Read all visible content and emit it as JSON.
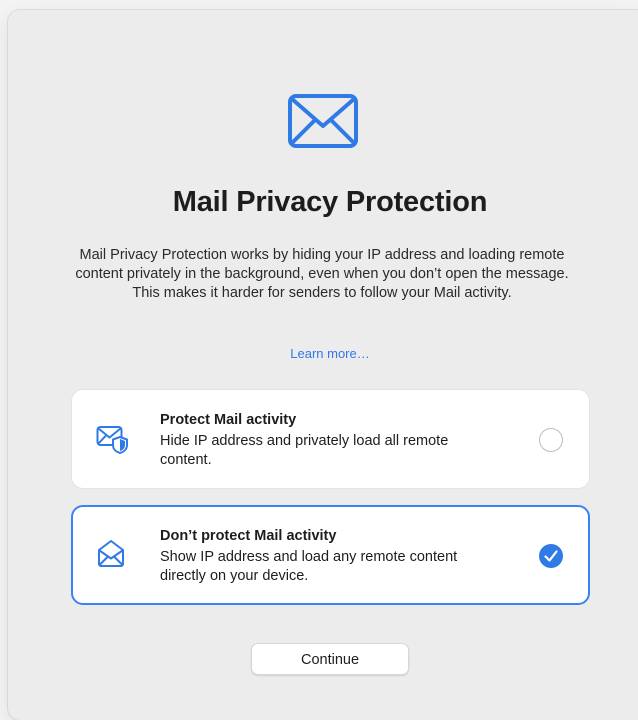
{
  "header": {
    "icon": "envelope-icon",
    "title": "Mail Privacy Protection",
    "description": "Mail Privacy Protection works by hiding your IP address and loading remote content privately in the background, even when you don’t open the message. This makes it harder for senders to follow your Mail activity.",
    "learn_more": "Learn more…"
  },
  "options": [
    {
      "icon": "envelope-shield-icon",
      "title": "Protect Mail activity",
      "description": "Hide IP address and privately load all remote content.",
      "selected": false
    },
    {
      "icon": "open-envelope-icon",
      "title": "Don’t protect Mail activity",
      "description": "Show IP address and load any remote content directly on your device.",
      "selected": true
    }
  ],
  "footer": {
    "continue_label": "Continue"
  },
  "colors": {
    "accent": "#2f7ae5",
    "selected_border": "#3a82f6",
    "background": "#ececec",
    "card": "#ffffff"
  }
}
